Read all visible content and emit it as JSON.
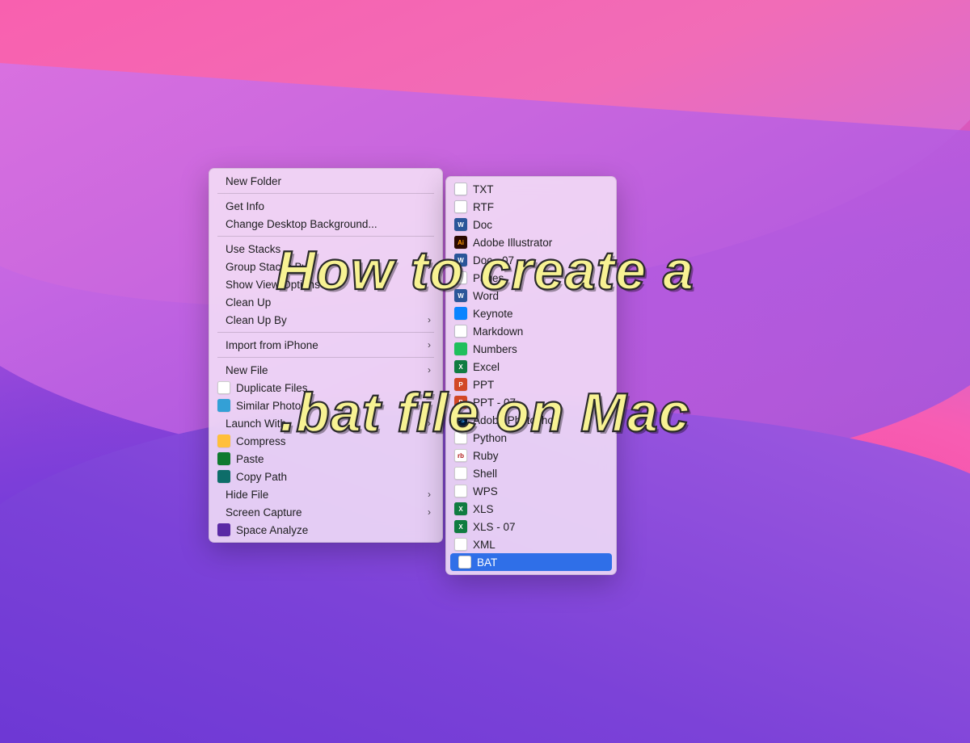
{
  "headline": {
    "line1": "How to create a",
    "line2": ".bat file on Mac"
  },
  "context_menu": {
    "new_folder": "New Folder",
    "get_info": "Get Info",
    "change_bg": "Change Desktop Background...",
    "use_stacks": "Use Stacks",
    "group_stacks": "Group Stacks By",
    "show_view": "Show View Options",
    "clean_up": "Clean Up",
    "clean_up_by": "Clean Up By",
    "import_iphone": "Import from iPhone",
    "new_file": "New File",
    "dup_files": "Duplicate Files",
    "sim_photos": "Similar Photos",
    "launch_with": "Launch With",
    "compress": "Compress",
    "paste": "Paste",
    "copy_path": "Copy Path",
    "hide_file": "Hide File",
    "screen_capture": "Screen Capture",
    "space_analyze": "Space Analyze"
  },
  "submenu": {
    "txt": "TXT",
    "rtf": "RTF",
    "doc": "Doc",
    "ai": "Adobe Illustrator",
    "doc07": "Doc - 07",
    "pages": "Pages",
    "word": "Word",
    "keynote": "Keynote",
    "markdown": "Markdown",
    "numbers": "Numbers",
    "excel": "Excel",
    "ppt": "PPT",
    "ppt07": "PPT - 07",
    "ps": "Adobe Photoshop",
    "python": "Python",
    "ruby": "Ruby",
    "shell": "Shell",
    "wps": "WPS",
    "xls": "XLS",
    "xls07": "XLS - 07",
    "xml": "XML",
    "bat": "BAT"
  }
}
